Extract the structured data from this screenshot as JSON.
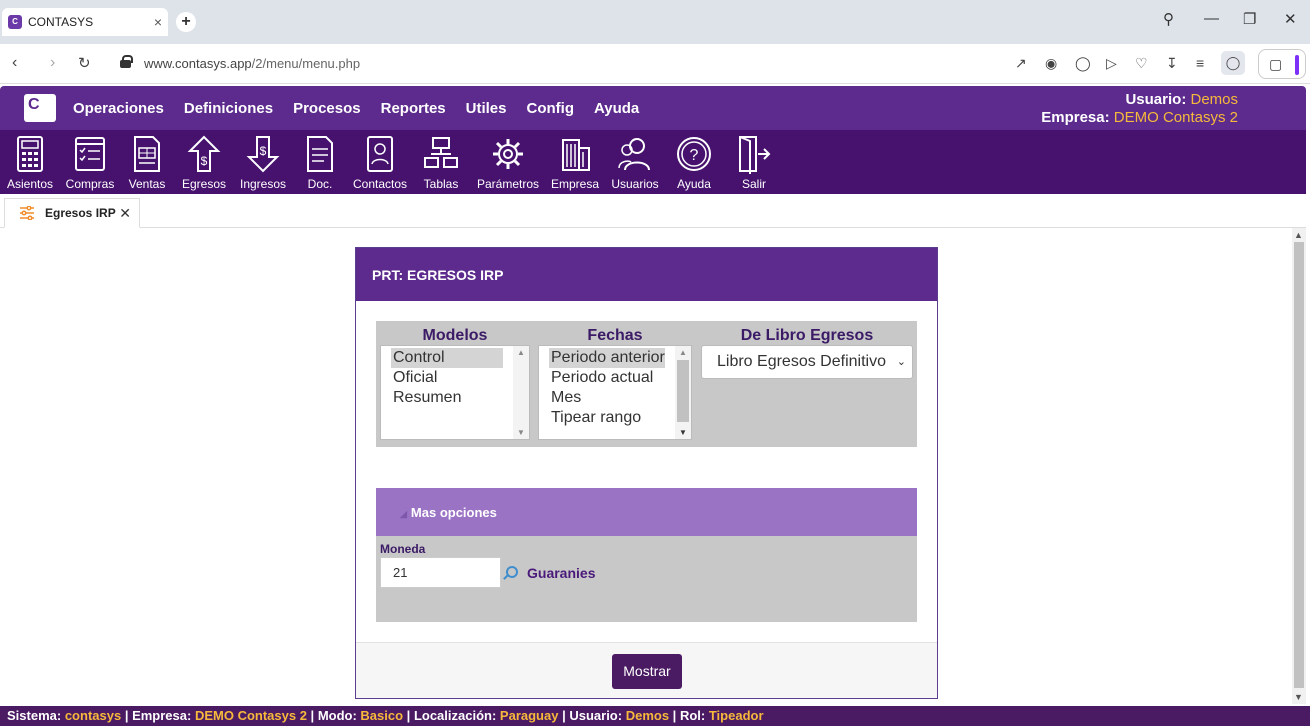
{
  "browser": {
    "tab_title": "CONTASYS",
    "url_host": "www.contasys.app",
    "url_path": "/2/menu/menu.php"
  },
  "menu": [
    "Operaciones",
    "Definiciones",
    "Procesos",
    "Reportes",
    "Utiles",
    "Config",
    "Ayuda"
  ],
  "user": {
    "usuario_label": "Usuario:",
    "usuario_value": "Demos",
    "empresa_label": "Empresa:",
    "empresa_value": "DEMO Contasys 2"
  },
  "toolbar": [
    "Asientos",
    "Compras",
    "Ventas",
    "Egresos",
    "Ingresos",
    "Doc.",
    "Contactos",
    "Tablas",
    "Parámetros",
    "Empresa",
    "Usuarios",
    "Ayuda",
    "Salir"
  ],
  "app_tab": {
    "label": "Egresos IRP"
  },
  "dialog": {
    "title": "PRT: EGRESOS IRP",
    "modelos": {
      "label": "Modelos",
      "options": [
        "Control",
        "Oficial",
        "Resumen"
      ],
      "selected": "Control"
    },
    "fechas": {
      "label": "Fechas",
      "options": [
        "Periodo anterior",
        "Periodo actual",
        "Mes",
        "Tipear rango"
      ],
      "selected": "Periodo anterior"
    },
    "libro": {
      "label": "De Libro Egresos",
      "selected": "Libro Egresos Definitivo"
    },
    "mas_opciones": "Mas opciones",
    "moneda": {
      "label": "Moneda",
      "value": "21",
      "name": "Guaranies"
    },
    "mostrar": "Mostrar"
  },
  "status": {
    "sistema_label": "Sistema:",
    "sistema": "contasys",
    "empresa_label": "Empresa:",
    "empresa": "DEMO Contasys 2",
    "modo_label": "Modo:",
    "modo": "Basico",
    "loc_label": "Localización:",
    "loc": "Paraguay",
    "usuario_label": "Usuario:",
    "usuario": "Demos",
    "rol_label": "Rol:",
    "rol": "Tipeador"
  },
  "colors": {
    "header": "#5c2b8d",
    "toolbar": "#46126e",
    "accent": "#f6b93b",
    "options_bar": "#9b73c4"
  }
}
